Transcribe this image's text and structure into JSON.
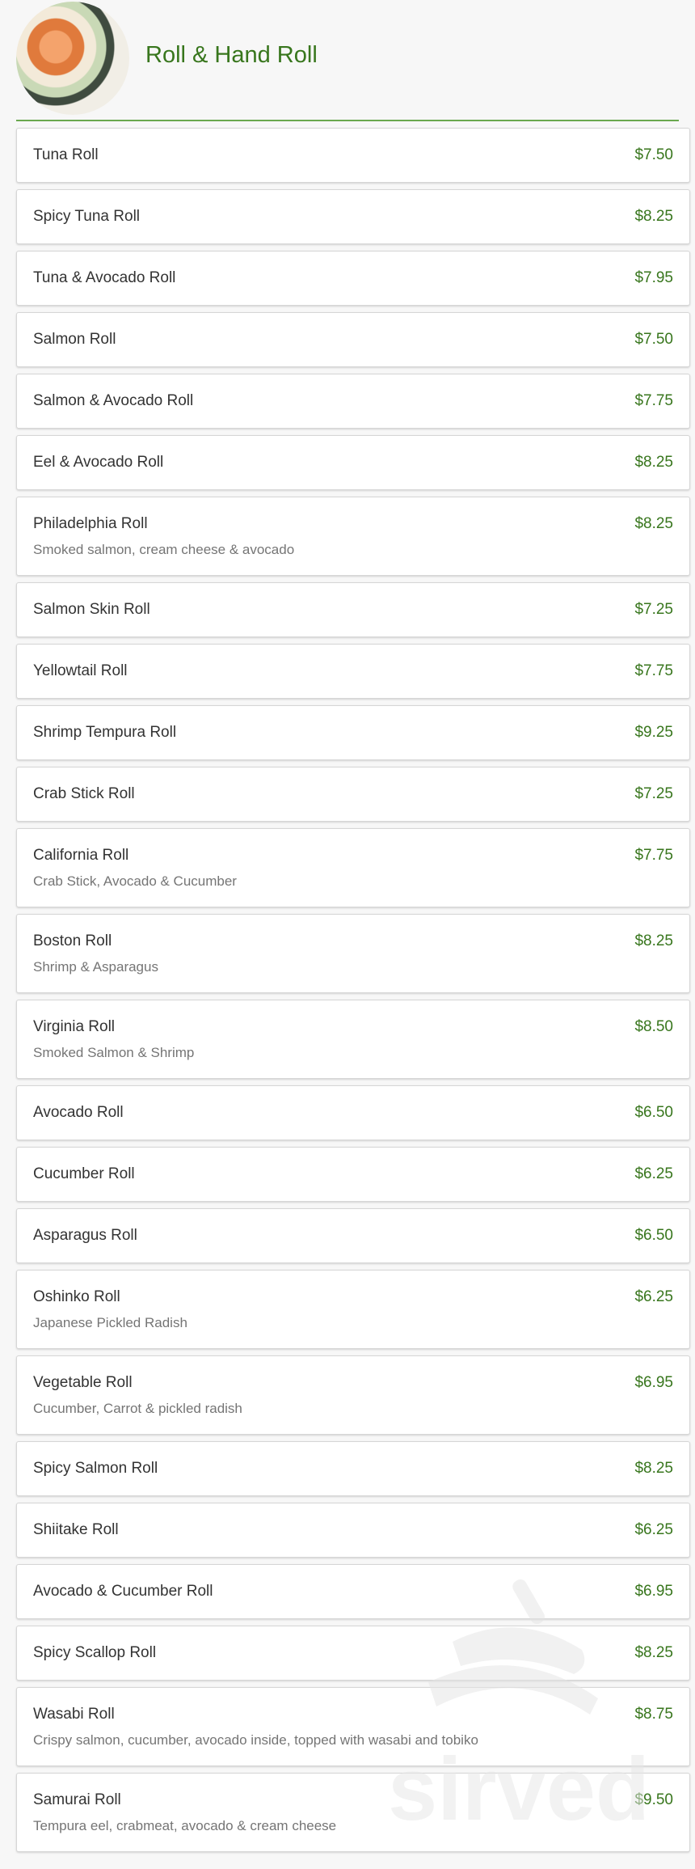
{
  "header": {
    "title": "Roll & Hand Roll",
    "image_icon": "sushi-roll-image"
  },
  "watermark": {
    "text": "sirved"
  },
  "items": [
    {
      "name": "Tuna Roll",
      "price": "$7.50",
      "desc": ""
    },
    {
      "name": "Spicy Tuna Roll",
      "price": "$8.25",
      "desc": ""
    },
    {
      "name": "Tuna & Avocado Roll",
      "price": "$7.95",
      "desc": ""
    },
    {
      "name": "Salmon Roll",
      "price": "$7.50",
      "desc": ""
    },
    {
      "name": "Salmon & Avocado Roll",
      "price": "$7.75",
      "desc": ""
    },
    {
      "name": "Eel & Avocado Roll",
      "price": "$8.25",
      "desc": ""
    },
    {
      "name": "Philadelphia Roll",
      "price": "$8.25",
      "desc": "Smoked salmon, cream cheese & avocado"
    },
    {
      "name": "Salmon Skin Roll",
      "price": "$7.25",
      "desc": ""
    },
    {
      "name": "Yellowtail Roll",
      "price": "$7.75",
      "desc": ""
    },
    {
      "name": "Shrimp Tempura Roll",
      "price": "$9.25",
      "desc": ""
    },
    {
      "name": "Crab Stick Roll",
      "price": "$7.25",
      "desc": ""
    },
    {
      "name": "California Roll",
      "price": "$7.75",
      "desc": "Crab Stick, Avocado & Cucumber"
    },
    {
      "name": "Boston Roll",
      "price": "$8.25",
      "desc": "Shrimp & Asparagus"
    },
    {
      "name": "Virginia Roll",
      "price": "$8.50",
      "desc": "Smoked Salmon & Shrimp"
    },
    {
      "name": "Avocado Roll",
      "price": "$6.50",
      "desc": ""
    },
    {
      "name": "Cucumber Roll",
      "price": "$6.25",
      "desc": ""
    },
    {
      "name": "Asparagus Roll",
      "price": "$6.50",
      "desc": ""
    },
    {
      "name": "Oshinko Roll",
      "price": "$6.25",
      "desc": "Japanese Pickled Radish"
    },
    {
      "name": "Vegetable Roll",
      "price": "$6.95",
      "desc": "Cucumber, Carrot & pickled radish"
    },
    {
      "name": "Spicy Salmon Roll",
      "price": "$8.25",
      "desc": ""
    },
    {
      "name": "Shiitake Roll",
      "price": "$6.25",
      "desc": ""
    },
    {
      "name": "Avocado & Cucumber Roll",
      "price": "$6.95",
      "desc": ""
    },
    {
      "name": "Spicy Scallop Roll",
      "price": "$8.25",
      "desc": ""
    },
    {
      "name": "Wasabi Roll",
      "price": "$8.75",
      "desc": "Crispy salmon, cucumber, avocado inside, topped with wasabi and tobiko"
    },
    {
      "name": "Samurai Roll",
      "price": "$9.50",
      "desc": "Tempura eel, crabmeat, avocado & cream cheese"
    }
  ]
}
